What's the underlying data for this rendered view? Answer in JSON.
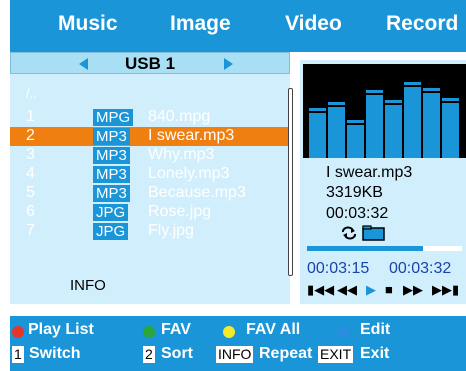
{
  "tabs": [
    "Music",
    "Image",
    "Video",
    "Record"
  ],
  "usb": {
    "title": "USB 1"
  },
  "parent_dir": "/..",
  "files": [
    {
      "num": "1",
      "type": "MPG",
      "name": "840.mpg",
      "selected": false
    },
    {
      "num": "2",
      "type": "MP3",
      "name": "I swear.mp3",
      "selected": true
    },
    {
      "num": "3",
      "type": "MP3",
      "name": "Why.mp3",
      "selected": false
    },
    {
      "num": "4",
      "type": "MP3",
      "name": "Lonely.mp3",
      "selected": false
    },
    {
      "num": "5",
      "type": "MP3",
      "name": "Because.mp3",
      "selected": false
    },
    {
      "num": "6",
      "type": "JPG",
      "name": "Rose.jpg",
      "selected": false
    },
    {
      "num": "7",
      "type": "JPG",
      "name": "Fly.jpg",
      "selected": false
    }
  ],
  "info_label": "INFO",
  "now_playing": {
    "filename": "I swear.mp3",
    "size": "3319KB",
    "duration": "00:03:32",
    "elapsed": "00:03:15",
    "total": "00:03:32",
    "progress": 0.75,
    "equalizer_levels": [
      0.62,
      0.7,
      0.48,
      0.85,
      0.72,
      0.95,
      0.88,
      0.75
    ]
  },
  "controls": {
    "buttons": [
      "prev-track-icon",
      "rewind-icon",
      "play-icon",
      "stop-icon",
      "fast-forward-icon",
      "next-track-icon"
    ]
  },
  "bottom": {
    "color_buttons": [
      {
        "label": "Play List",
        "color": "#e8352c"
      },
      {
        "label": "FAV",
        "color": "#2ca53a"
      },
      {
        "label": "FAV All",
        "color": "#f3ea2a"
      },
      {
        "label": "Edit",
        "color": "#2a8ee0"
      }
    ],
    "keys": [
      {
        "key": "1",
        "label": "Switch"
      },
      {
        "key": "2",
        "label": "Sort"
      },
      {
        "key": "INFO",
        "label": "Repeat"
      },
      {
        "key": "EXIT",
        "label": "Exit"
      }
    ]
  },
  "colors": {
    "accent": "#1a95d7",
    "selection": "#f07f12",
    "panel": "#d1eefc"
  }
}
